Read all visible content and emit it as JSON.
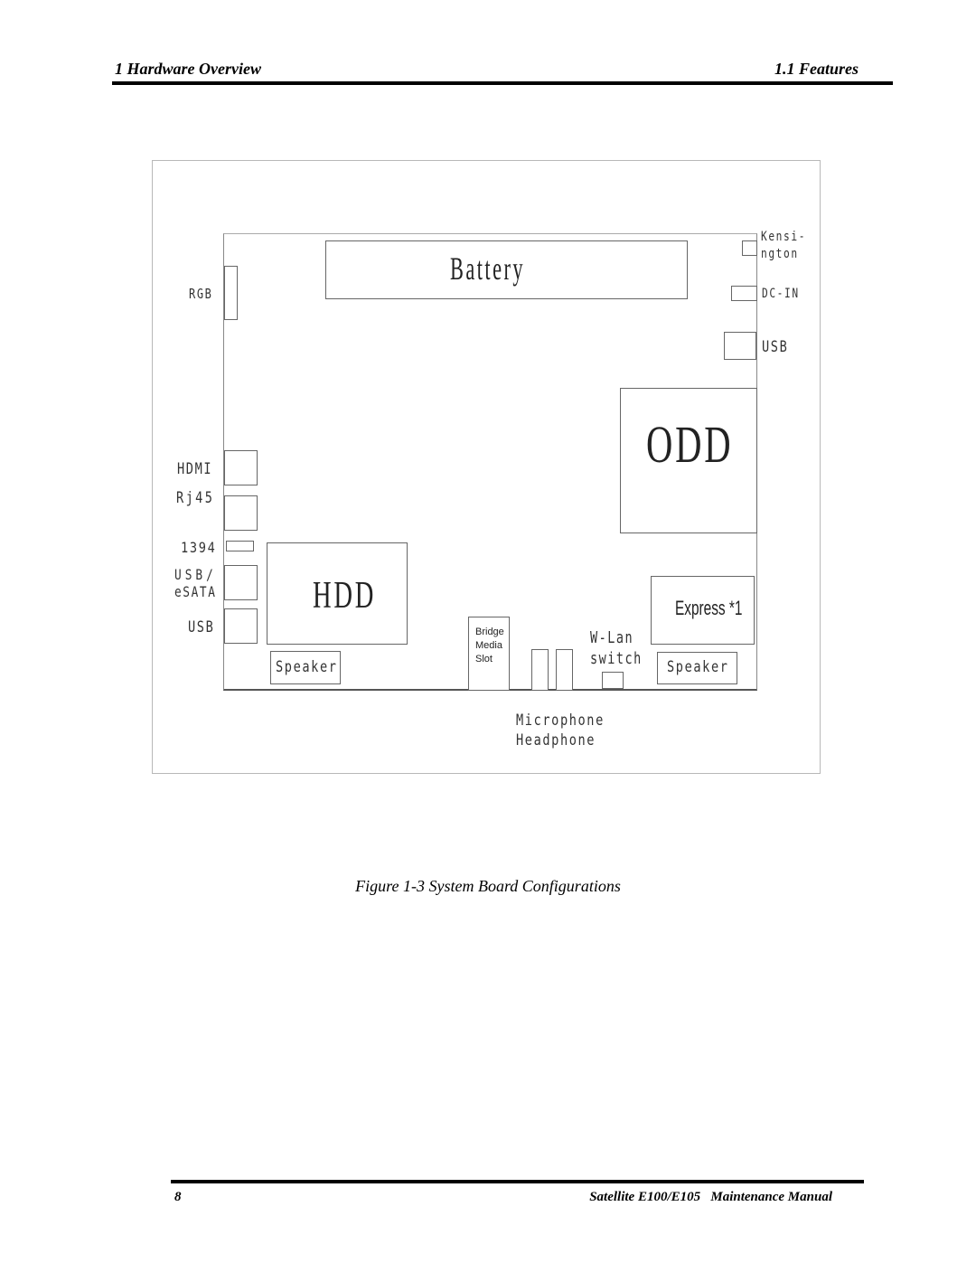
{
  "header": {
    "chapter": "1 Hardware Overview",
    "section": "1.1 Features"
  },
  "figure": {
    "caption": "Figure 1-3 System Board Configurations",
    "components": {
      "battery": "Battery",
      "odd": "ODD",
      "hdd": "HDD",
      "express": "Express *1",
      "bridge_media_slot": [
        "Bridge",
        "Media",
        "Slot"
      ],
      "speaker_left": "Speaker",
      "speaker_right": "Speaker",
      "wlan_switch": [
        "W-Lan",
        "switch"
      ]
    },
    "ports": {
      "rgb": "RGB",
      "hdmi": "HDMI",
      "rj45": "Rj45",
      "ieee1394": "1394",
      "usb_esata": [
        "USB/",
        "eSATA"
      ],
      "usb_left": "USB",
      "kensington": [
        "Kensi-",
        "ngton"
      ],
      "dc_in": "DC-IN",
      "usb_right": "USB",
      "audio": [
        "Microphone",
        "Headphone"
      ]
    }
  },
  "footer": {
    "page_number": "8",
    "manual_title": "Satellite E100/E105   Maintenance Manual"
  }
}
